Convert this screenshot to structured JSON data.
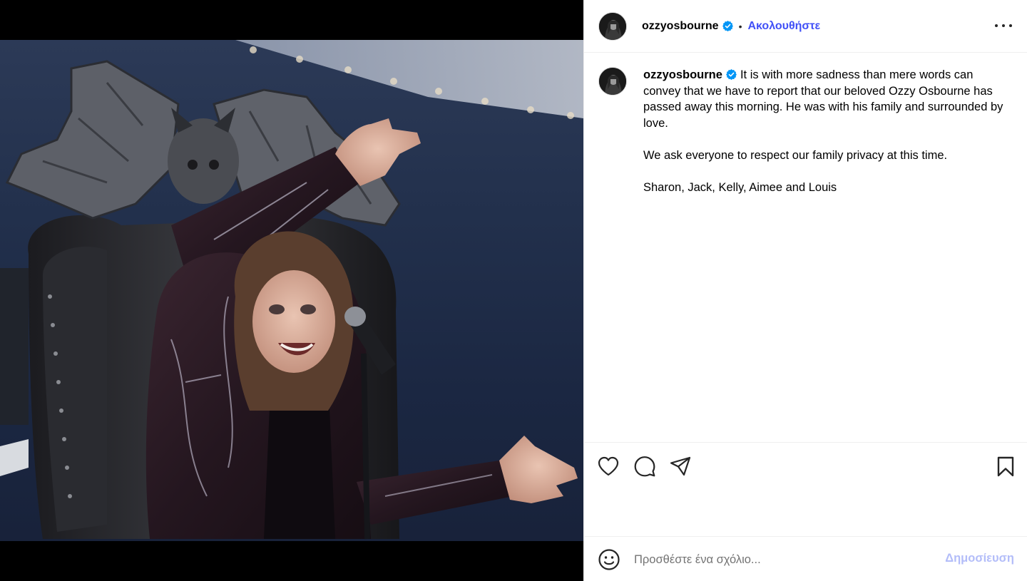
{
  "post": {
    "username": "ozzyosbourne",
    "follow_label": "Ακολουθήστε",
    "separator": "•",
    "caption_lines": [
      "It is with more sadness than mere words can convey that we have to report that our beloved Ozzy Osbourne has passed away this morning. He was with his family and surrounded by love.",
      "We ask everyone to respect our family privacy at this time.",
      "Sharon, Jack, Kelly, Aimee and Louis"
    ]
  },
  "comment": {
    "placeholder": "Προσθέστε ένα σχόλιο...",
    "post_label": "Δημοσίευση"
  },
  "colors": {
    "follow_blue": "#4150f7",
    "verified_blue": "#0095f6",
    "post_disabled": "#b3bdf9"
  },
  "icons": {
    "like": "heart-icon",
    "comment": "comment-bubble-icon",
    "share": "paper-plane-icon",
    "save": "bookmark-icon",
    "emoji": "smiley-icon",
    "more": "more-options-icon",
    "verified": "verified-badge-icon"
  }
}
